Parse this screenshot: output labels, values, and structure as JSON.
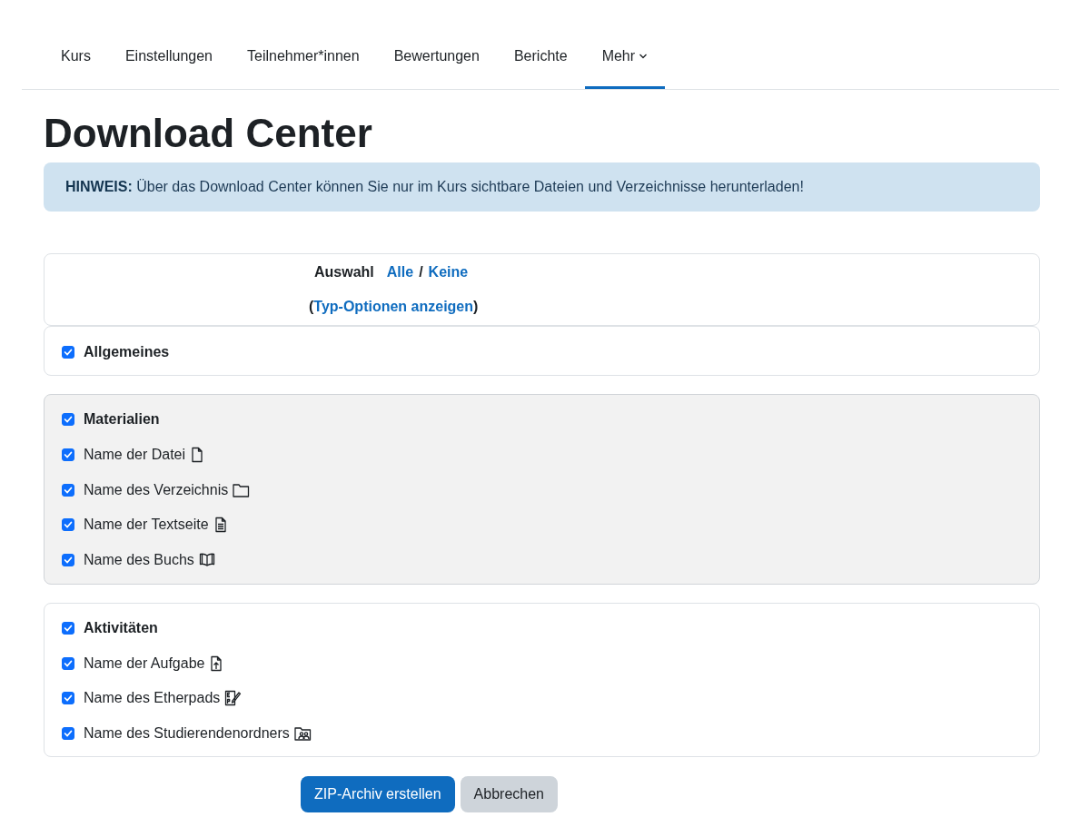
{
  "nav": {
    "tabs": [
      {
        "label": "Kurs",
        "selected": false,
        "dropdown": false
      },
      {
        "label": "Einstellungen",
        "selected": false,
        "dropdown": false
      },
      {
        "label": "Teilnehmer*innen",
        "selected": false,
        "dropdown": false
      },
      {
        "label": "Bewertungen",
        "selected": false,
        "dropdown": false
      },
      {
        "label": "Berichte",
        "selected": false,
        "dropdown": false
      },
      {
        "label": "Mehr",
        "selected": true,
        "dropdown": true
      }
    ]
  },
  "title": "Download Center",
  "notice": {
    "label": "HINWEIS:",
    "text": "Über das Download Center können Sie nur im Kurs sichtbare Dateien und Verzeichnisse herunterladen!"
  },
  "selection": {
    "label": "Auswahl",
    "all": "Alle",
    "separator": "/",
    "none": "Keine",
    "open_paren": "(",
    "type_options": "Typ-Optionen anzeigen",
    "close_paren": ")"
  },
  "sections": [
    {
      "title": "Allgemeines",
      "checked": true,
      "highlighted": false
    },
    {
      "title": "Materialien",
      "checked": true,
      "highlighted": true,
      "items": [
        {
          "label": "Name der Datei",
          "checked": true,
          "kind": "file"
        },
        {
          "label": "Name des Verzeichnis",
          "checked": true,
          "kind": "folder"
        },
        {
          "label": "Name der Textseite",
          "checked": true,
          "kind": "page"
        },
        {
          "label": "Name des Buchs",
          "checked": true,
          "kind": "book"
        }
      ]
    },
    {
      "title": "Aktivitäten",
      "checked": true,
      "highlighted": false,
      "items": [
        {
          "label": "Name der Aufgabe",
          "checked": true,
          "kind": "assignment"
        },
        {
          "label": "Name des Etherpads",
          "checked": true,
          "kind": "etherpad"
        },
        {
          "label": "Name des Studierendenordners",
          "checked": true,
          "kind": "studentfolder"
        }
      ]
    }
  ],
  "buttons": [
    {
      "label": "ZIP-Archiv erstellen",
      "kind": "primary"
    },
    {
      "label": "Abbrechen",
      "kind": "secondary"
    }
  ]
}
